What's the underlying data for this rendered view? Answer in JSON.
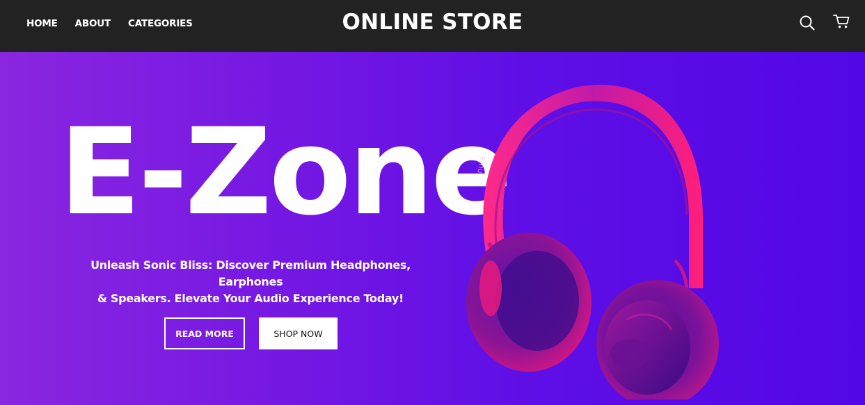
{
  "nav": {
    "links": [
      {
        "label": "HOME"
      },
      {
        "label": "ABOUT"
      },
      {
        "label": "CATEGORIES"
      }
    ],
    "brand": "ONLINE STORE",
    "icons": {
      "search": "search-icon",
      "cart": "cart-icon"
    }
  },
  "hero": {
    "title": "E-Zone",
    "tagline_line1": "Unleash Sonic Bliss: Discover Premium Headphones, Earphones",
    "tagline_line2": "& Speakers. Elevate Your Audio Experience Today!",
    "read_more_label": "READ MORE",
    "shop_now_label": "SHOP NOW",
    "product_brand": "nura",
    "image": "headphones-product-image"
  },
  "colors": {
    "navbar_bg": "#222222",
    "hero_gradient_start": "#8a26e0",
    "hero_gradient_end": "#5207e6",
    "headphone_pink": "#e5187a",
    "text": "#ffffff"
  }
}
